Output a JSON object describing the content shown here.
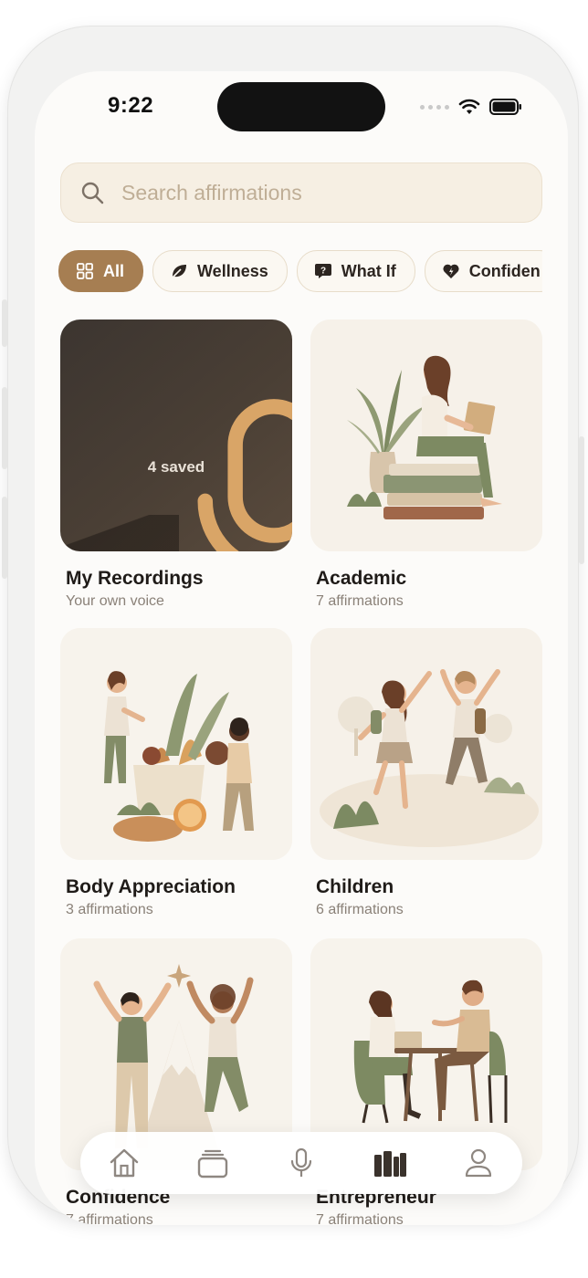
{
  "status": {
    "time": "9:22"
  },
  "search": {
    "placeholder": "Search affirmations",
    "value": ""
  },
  "filters": [
    {
      "label": "All",
      "icon": "grid-icon",
      "active": true
    },
    {
      "label": "Wellness",
      "icon": "leaf-icon",
      "active": false
    },
    {
      "label": "What If",
      "icon": "question-bubble-icon",
      "active": false
    },
    {
      "label": "Confiden",
      "icon": "heart-bolt-icon",
      "active": false
    }
  ],
  "recordings": {
    "title": "My Recordings",
    "subtitle": "Your own voice",
    "count_label": "4 saved",
    "icon": "microphone-icon"
  },
  "categories": [
    {
      "title": "Academic",
      "subtitle": "7 affirmations"
    },
    {
      "title": "Body Appreciation",
      "subtitle": "3 affirmations"
    },
    {
      "title": "Children",
      "subtitle": "6 affirmations"
    },
    {
      "title": "Confidence",
      "subtitle": "7 affirmations"
    },
    {
      "title": "Entrepreneur",
      "subtitle": "7 affirmations"
    }
  ],
  "tabbar": [
    "home-icon",
    "cards-icon",
    "microphone-icon",
    "library-icon",
    "profile-icon"
  ],
  "colors": {
    "accent": "#a67e52",
    "card_bg": "#f6f1e9",
    "search_bg": "#f6efe3",
    "dark_card": "#3c3530"
  }
}
